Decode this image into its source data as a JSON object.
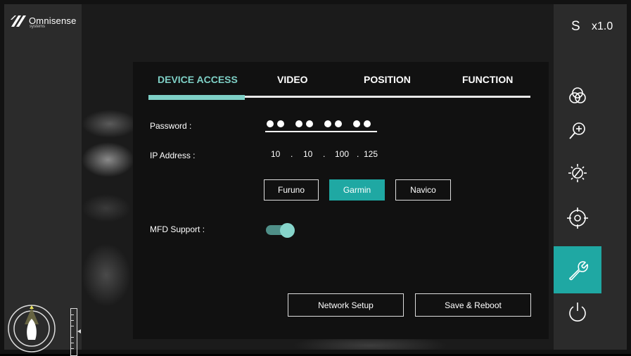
{
  "brand": {
    "name": "Omnisense",
    "sub": "systems"
  },
  "status": {
    "mode": "S",
    "zoom": "x1.0"
  },
  "right_toolbar": [
    {
      "icon": "color-palette-icon",
      "active": false
    },
    {
      "icon": "zoom-in-icon",
      "active": false
    },
    {
      "icon": "brightness-icon",
      "active": false
    },
    {
      "icon": "target-icon",
      "active": false
    },
    {
      "icon": "settings-wrench-icon",
      "active": true
    },
    {
      "icon": "power-icon",
      "active": false
    }
  ],
  "dialog": {
    "tabs": [
      {
        "label": "DEVICE ACCESS",
        "active": true
      },
      {
        "label": "VIDEO",
        "active": false
      },
      {
        "label": "POSITION",
        "active": false
      },
      {
        "label": "FUNCTION",
        "active": false
      }
    ],
    "password_label": "Password :",
    "ip_label": "IP Address :",
    "ip": {
      "o1": "10",
      "sep1": ".",
      "o2": "10",
      "sep2": ".",
      "o3": "100",
      "sep3": ".",
      "o4": "125"
    },
    "mfd_options": [
      {
        "label": "Furuno",
        "selected": false
      },
      {
        "label": "Garmin",
        "selected": true
      },
      {
        "label": "Navico",
        "selected": false
      }
    ],
    "mfd_support_label": "MFD Support :",
    "mfd_support_enabled": true,
    "network_setup_label": "Network Setup",
    "save_reboot_label": "Save & Reboot"
  },
  "colors": {
    "accent": "#1fa8a3",
    "tab_active": "#7ed0c6",
    "panel": "#2b2b2b",
    "dialog": "#111111"
  }
}
